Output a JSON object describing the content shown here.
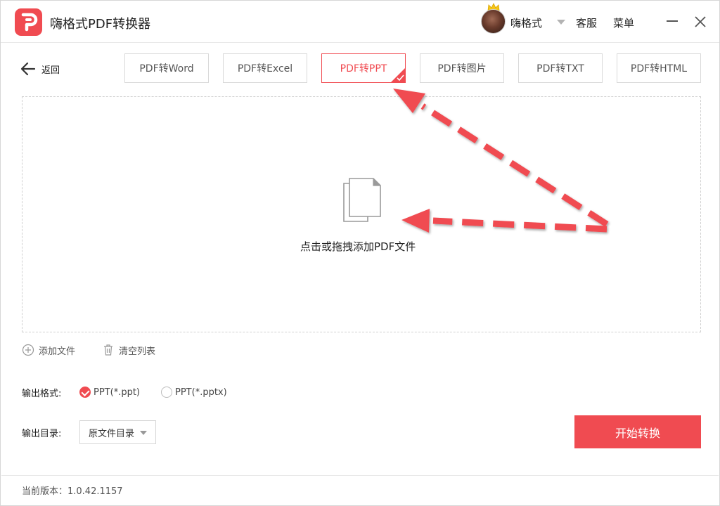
{
  "app": {
    "title": "嗨格式PDF转换器"
  },
  "header": {
    "user_name": "嗨格式",
    "service_label": "客服",
    "menu_label": "菜单"
  },
  "nav": {
    "back_label": "返回",
    "tabs": [
      {
        "label": "PDF转Word",
        "active": false
      },
      {
        "label": "PDF转Excel",
        "active": false
      },
      {
        "label": "PDF转PPT",
        "active": true
      },
      {
        "label": "PDF转图片",
        "active": false
      },
      {
        "label": "PDF转TXT",
        "active": false
      },
      {
        "label": "PDF转HTML",
        "active": false
      }
    ]
  },
  "dropzone": {
    "text": "点击或拖拽添加PDF文件"
  },
  "actions": {
    "add_file": "添加文件",
    "clear_list": "清空列表"
  },
  "output": {
    "format_label": "输出格式:",
    "formats": [
      {
        "label": "PPT(*.ppt)",
        "selected": true
      },
      {
        "label": "PPT(*.pptx)",
        "selected": false
      }
    ],
    "dir_label": "输出目录:",
    "dir_value": "原文件目录"
  },
  "start_button": "开始转换",
  "footer": {
    "version_text": "当前版本：1.0.42.1157"
  },
  "colors": {
    "accent": "#f04b51",
    "annotation_arrow": "#f04b51"
  },
  "icons": [
    "app-logo-icon",
    "crown-icon",
    "close-icon",
    "minimize-icon",
    "back-arrow-icon",
    "check-corner-icon",
    "file-icon",
    "add-circle-icon",
    "trash-icon"
  ]
}
